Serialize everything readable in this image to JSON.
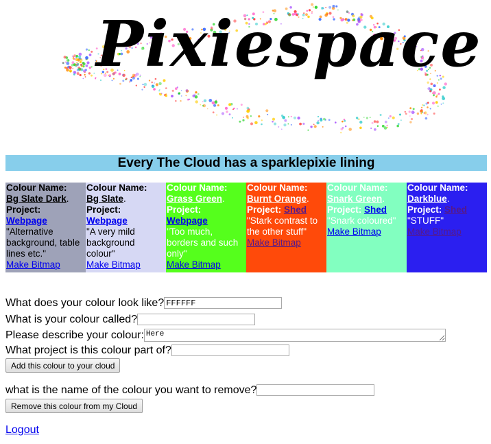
{
  "logo": {
    "text": "Pixiespace"
  },
  "banner": {
    "text": "Every The Cloud has a sparklepixie lining"
  },
  "colours": [
    {
      "bg": "#9ea2b8",
      "fg": "#000000",
      "link_color": "#0000ee",
      "name_label": "Colour Name:",
      "name": "Bg Slate Dark",
      "project_label": "Project:",
      "project": "Webpage",
      "description": "\"Alternative background, table lines etc.\"",
      "make": "Make Bitmap"
    },
    {
      "bg": "#d6d8f4",
      "fg": "#000000",
      "link_color": "#0000ee",
      "name_label": "Colour Name:",
      "name": "Bg Slate",
      "project_label": "Project:",
      "project": "Webpage",
      "description": "\"A very mild background colour\"",
      "make": "Make Bitmap"
    },
    {
      "bg": "#55ff1c",
      "fg": "#ffffff",
      "link_color": "#0000ee",
      "name_label": "Colour Name:",
      "name": "Grass Green",
      "project_label": "Project:",
      "project": "Webpage",
      "description": "\"Too much, borders and such only\"",
      "make": "Make Bitmap"
    },
    {
      "bg": "#ff4a0a",
      "fg": "#ffffff",
      "link_color": "#551a8b",
      "name_label": "Colour Name:",
      "name": "Burnt Orange",
      "project_label": "Project:",
      "project": "Shed",
      "description": "\"Stark contrast to the other stuff\"",
      "make": "Make Bitmap"
    },
    {
      "bg": "#82ffc0",
      "fg": "#ffffff",
      "link_color": "#0000ee",
      "name_label": "Colour Name:",
      "name": "Snark Green",
      "project_label": "Project:",
      "project": "Shed",
      "description": "\"Snark coloured\"",
      "make": "Make Bitmap"
    },
    {
      "bg": "#2b1ff0",
      "fg": "#ffffff",
      "link_color": "#551a8b",
      "name_label": "Colour Name:",
      "name": "Darkblue",
      "project_label": "Project:",
      "project": "Shed",
      "description": "\"STUFF\"",
      "make": "Make Bitmap"
    }
  ],
  "form": {
    "look_label": "What does your colour look like?",
    "look_value": "FFFFFF",
    "called_label": "What is your colour called?",
    "called_value": "",
    "describe_label": "Please describe your colour:",
    "describe_value": "Here",
    "project_label": "What project is this colour part of?",
    "project_value": "",
    "add_button": "Add this colour to your cloud",
    "remove_label": "what is the name of the colour you want to remove?",
    "remove_value": "",
    "remove_button": "Remove this colour from my Cloud"
  },
  "logout": "Logout"
}
